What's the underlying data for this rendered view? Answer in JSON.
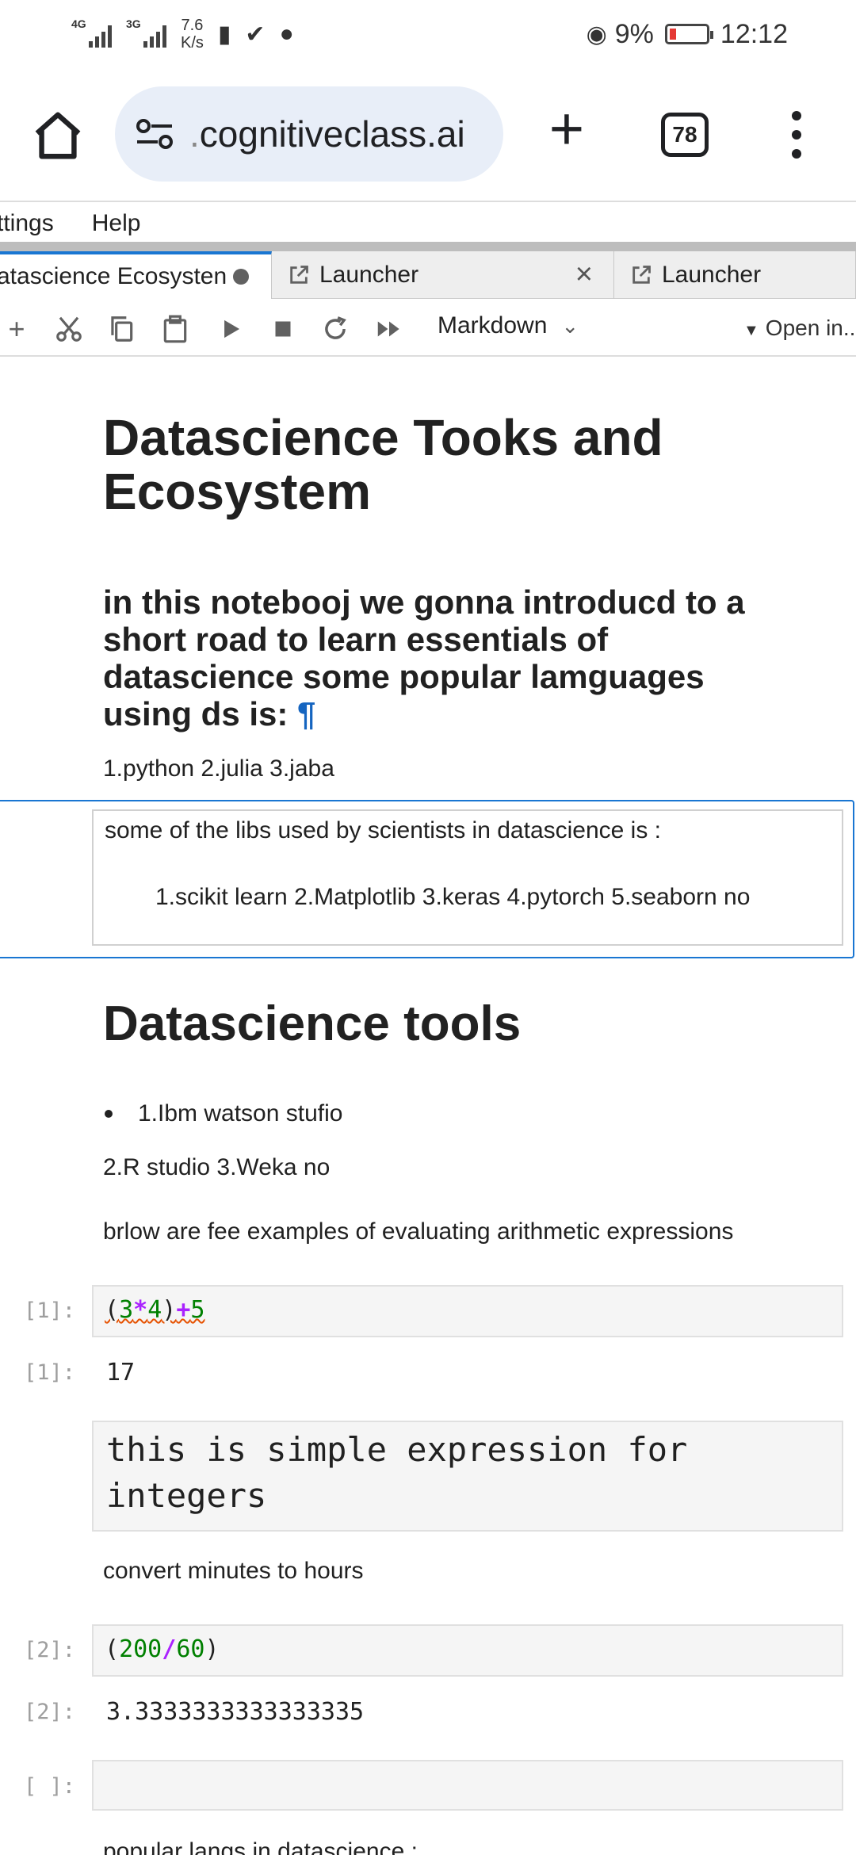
{
  "status_bar": {
    "net1": "4G",
    "net2": "3G",
    "speed_value": "7.6",
    "speed_unit": "K/s",
    "battery": "9%",
    "time": "12:12"
  },
  "browser": {
    "url_dim": ".",
    "url": "cognitiveclass.ai",
    "tab_count": "78"
  },
  "menubar": {
    "items": [
      "ttings",
      "Help"
    ]
  },
  "tabs": [
    {
      "label": "atascience Ecosysten"
    },
    {
      "label": "Launcher"
    },
    {
      "label": "Launcher"
    }
  ],
  "toolbar": {
    "cell_type": "Markdown",
    "open_in": "Open in..."
  },
  "notebook": {
    "h1_line1": "Datascience Tooks and",
    "h1_line2": "Ecosystem",
    "h2_line1": "in this notebooj we gonna introducd to a",
    "h2_line2": "short road to learn essentials of",
    "h2_line3": "datascience some popular lamguages",
    "h2_line4": "using ds is:",
    "pilcrow": "¶",
    "langs": "1.python 2.julia 3.jaba",
    "edit_line1": "some of the libs used by scientists in datascience is :",
    "edit_line2": "1.scikit learn 2.Matplotlib 3.keras 4.pytorch 5.seaborn no",
    "tools_heading": "Datascience tools",
    "tools_bullet": "1.Ibm watson stufio",
    "tools_rest": "2.R studio 3.Weka no",
    "examples_text": "brlow are fee examples of evaluating arithmetic expressions",
    "cell1_prompt": "[1]:",
    "cell1_open": "(",
    "cell1_n1": "3",
    "cell1_op1": "*",
    "cell1_n2": "4",
    "cell1_close": ")",
    "cell1_op2": "+",
    "cell1_n3": "5",
    "out1_prompt": "[1]:",
    "out1_value": "17",
    "raw_line1": "this is simple expression for",
    "raw_line2": "integers",
    "convert_text": "convert minutes to hours",
    "cell2_prompt": "[2]:",
    "cell2_open": "(",
    "cell2_n1": "200",
    "cell2_op": "/",
    "cell2_n2": "60",
    "cell2_close": ")",
    "out2_prompt": "[2]:",
    "out2_value": "3.3333333333333335",
    "cell3_prompt": "[ ]:",
    "bottom_text": "popular langs in datascience :"
  }
}
